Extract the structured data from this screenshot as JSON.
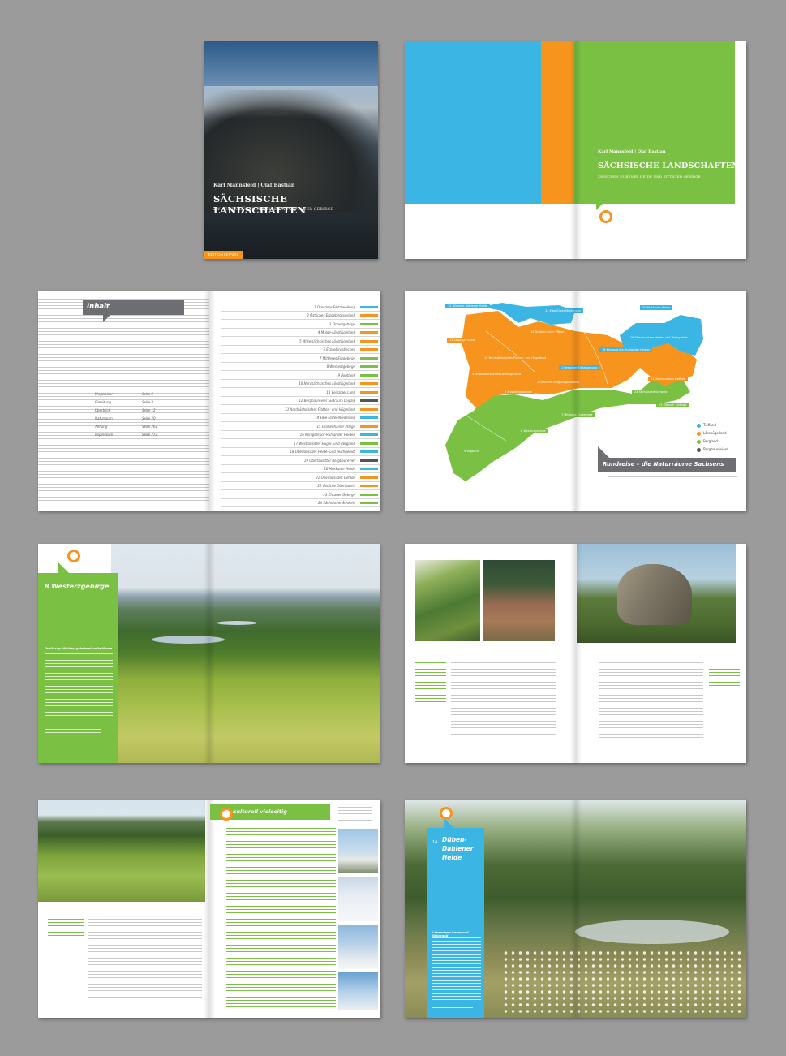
{
  "colors": {
    "green": "#7ac143",
    "blue": "#3bb5e4",
    "orange": "#f7941d",
    "darkgray": "#555555"
  },
  "cover": {
    "authors": "Karl Mannsfeld | Olaf Bastian",
    "title": "SÄCHSISCHE LANDSCHAFTEN",
    "subtitle": "ZWISCHEN DÜBENER HEIDE UND ZITTAUER GEBIRGE",
    "publisher": "EDITION LEIPZIG"
  },
  "title_spread": {
    "authors": "Karl Mannsfeld | Olaf Bastian",
    "title": "SÄCHSISCHE LANDSCHAFTEN",
    "subtitle": "ZWISCHEN DÜBENER HEIDE UND ZITTAUER GEBIRGE"
  },
  "toc": {
    "heading": "Inhalt",
    "meta": [
      {
        "label": "Wegweiser",
        "page": "Seite 6"
      },
      {
        "label": "Einleitung",
        "page": "Seite 8"
      },
      {
        "label": "Überblick",
        "page": "Seite 12"
      },
      {
        "label": "Naturraum",
        "page": "Seite 20"
      },
      {
        "label": "Anhang",
        "page": "Seite 262"
      },
      {
        "label": "Impressum",
        "page": "Seite 272"
      }
    ],
    "entries": [
      {
        "label": "1 Dresdner Elbtalweitung",
        "color": "#3bb5e4"
      },
      {
        "label": "2 Östliches Erzgebirgsvorland",
        "color": "#f7941d"
      },
      {
        "label": "3 Osterzgebirge",
        "color": "#7ac143"
      },
      {
        "label": "4 Mulde-Lösshügelland",
        "color": "#f7941d"
      },
      {
        "label": "5 Mittelsächsisches Lösshügelland",
        "color": "#f7941d"
      },
      {
        "label": "6 Erzgebirgsbecken",
        "color": "#f7941d"
      },
      {
        "label": "7 Mittleres Erzgebirge",
        "color": "#7ac143"
      },
      {
        "label": "8 Westerzgebirge",
        "color": "#7ac143"
      },
      {
        "label": "9 Vogtland",
        "color": "#7ac143"
      },
      {
        "label": "10 Nordsächsisches Lösshügelland",
        "color": "#f7941d"
      },
      {
        "label": "11 Leipziger Land",
        "color": "#f7941d"
      },
      {
        "label": "12 Bergbaurevier Südraum Leipzig",
        "color": "#555555"
      },
      {
        "label": "13 Nordsächsisches Platten- und Hügelland",
        "color": "#f7941d"
      },
      {
        "label": "14 Elbe-Elster-Niederung",
        "color": "#3bb5e4"
      },
      {
        "label": "15 Großenhainer Pflege",
        "color": "#f7941d"
      },
      {
        "label": "16 Königsbrück-Ruhlander Heiden",
        "color": "#3bb5e4"
      },
      {
        "label": "17 Westlausitzer Hügel- und Bergland",
        "color": "#7ac143"
      },
      {
        "label": "18 Oberlausitzer Heide- und Teichgebiet",
        "color": "#3bb5e4"
      },
      {
        "label": "19 Oberlausitzer Bergbaurevier",
        "color": "#555555"
      },
      {
        "label": "20 Muskauer Heide",
        "color": "#3bb5e4"
      },
      {
        "label": "21 Oberlausitzer Gefilde",
        "color": "#f7941d"
      },
      {
        "label": "22 Östliche Oberlausitz",
        "color": "#f7941d"
      },
      {
        "label": "23 Zittauer Gebirge",
        "color": "#7ac143"
      },
      {
        "label": "24 Sächsische Schweiz",
        "color": "#7ac143"
      }
    ]
  },
  "map_spread": {
    "caption": "Rundreise – die Naturräume Sachsens",
    "legend": [
      {
        "label": "Tiefland",
        "color": "#3bb5e4"
      },
      {
        "label": "Lösshügelland",
        "color": "#f7941d"
      },
      {
        "label": "Bergland",
        "color": "#7ac143"
      },
      {
        "label": "Bergbaureviere",
        "color": "#555555"
      }
    ],
    "region_labels": [
      {
        "text": "14 Elbe-Elster-Niederung",
        "color": "#3bb5e4"
      },
      {
        "text": "12 Dübener-Dahlener Heide",
        "color": "#3bb5e4"
      },
      {
        "text": "15 Großenhainer Pflege",
        "color": "#f7941d"
      },
      {
        "text": "20 Muskauer Heide",
        "color": "#3bb5e4"
      },
      {
        "text": "11 Leipziger Land",
        "color": "#f7941d"
      },
      {
        "text": "13 Nordsächsisches Platten- und Hügelland",
        "color": "#f7941d"
      },
      {
        "text": "16 Königsbrück-Ruhlander Heiden",
        "color": "#3bb5e4"
      },
      {
        "text": "18 Oberlausitzer Heide- und Teichgebiet",
        "color": "#3bb5e4"
      },
      {
        "text": "1 Dresdner Elbtalweitung",
        "color": "#3bb5e4"
      },
      {
        "text": "21 Oberlausitzer Gefilde",
        "color": "#f7941d"
      },
      {
        "text": "5 Mittelsächsisches Lösshügelland",
        "color": "#f7941d"
      },
      {
        "text": "2 Östliches Erzgebirgsvorland",
        "color": "#f7941d"
      },
      {
        "text": "24 Sächsische Schweiz",
        "color": "#7ac143"
      },
      {
        "text": "23 Zittauer Gebirge",
        "color": "#7ac143"
      },
      {
        "text": "6 Erzgebirgsbecken",
        "color": "#f7941d"
      },
      {
        "text": "7 Mittleres Erzgebirge",
        "color": "#7ac143"
      },
      {
        "text": "9 Vogtland",
        "color": "#7ac143"
      },
      {
        "text": "8 Westerzgebirge",
        "color": "#7ac143"
      }
    ]
  },
  "westerzgebirge": {
    "chapter": "8 Westerzgebirge",
    "intro_heading": "Dreiklang: Wälder, geheimnisvolle Moore"
  },
  "rocks_spread": {
    "caption_left": "",
    "caption_right": ""
  },
  "kulturell": {
    "heading": "kulturell vielseitig"
  },
  "dueben": {
    "chapter_number": "14",
    "chapter": "Düben-Dahlener Heide",
    "intro_heading": "Lebendiger Raum und Waldrand"
  }
}
